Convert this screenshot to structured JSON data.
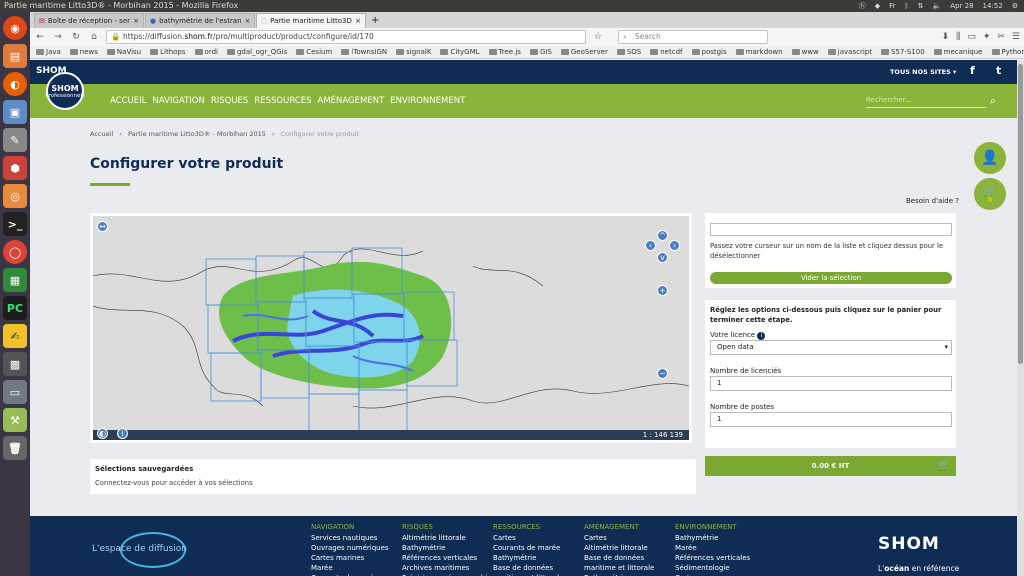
{
  "os": {
    "window_title": "Partie maritime Litto3D® - Morbihan 2015 - Mozilla Firefox",
    "tray": {
      "keyboard": "Fr",
      "date": "Apr 28",
      "time": "14:52"
    },
    "launcher_icons": [
      "ubuntu-icon",
      "files-icon",
      "firefox-icon",
      "virtualbox-icon",
      "settings-icon",
      "app-icon",
      "ubuntu-software-icon",
      "terminal-icon",
      "chrome-icon",
      "spreadsheet-icon",
      "pycharm-icon",
      "notes-icon",
      "qgis-icon",
      "drive-icon",
      "tool-icon",
      "trash-icon"
    ]
  },
  "browser": {
    "tabs": [
      {
        "label": "Boîte de réception - ser"
      },
      {
        "label": "bathymétrie de l'estran"
      },
      {
        "label": "Partie maritime Litto3D"
      }
    ],
    "url_prefix": "https://diffusion.",
    "url_host": "shom.fr",
    "url_path": "/pro/multiproduct/product/configure/id/170",
    "search_placeholder": "Search",
    "bookmarks": [
      "Java",
      "news",
      "NaVisu",
      "Lithops",
      "ordi",
      "gdal_ogr_QGis",
      "Cesium",
      "iTownsIGN",
      "signalK",
      "CityGML",
      "Tree.js",
      "GIS",
      "GeoServer",
      "SOS",
      "netcdf",
      "postgis",
      "markdown",
      "www",
      "javascript",
      "S57-S100",
      "mecanique",
      "Python",
      "Unity"
    ]
  },
  "site": {
    "logo": "SHOM",
    "tous_nos_sites": "TOUS NOS SITES",
    "social": {
      "facebook": "f",
      "twitter": "t"
    },
    "professionnels": "Professionnels",
    "menu": [
      "ACCUEIL",
      "NAVIGATION",
      "RISQUES",
      "RESSOURCES",
      "AMÉNAGEMENT",
      "ENVIRONNEMENT"
    ],
    "search_placeholder": "Rechercher...",
    "breadcrumb": [
      "Accueil",
      "Partie maritime Litto3D® - Morbihan 2015",
      "Configurer votre produit"
    ],
    "page_title": "Configurer votre produit",
    "help": "Besoin d'aide ?",
    "cart_count": "0",
    "map": {
      "scale": "1 : 146 139"
    },
    "selection": {
      "hint": "Passez votre curseur sur un nom de la liste et cliquez dessus pour le désélectionner",
      "clear_button": "Vider la sélection"
    },
    "options": {
      "intro": "Réglez les options ci-dessous puis cliquez sur le panier pour terminer cette étape.",
      "licence_label": "Votre licence",
      "licence_value": "Open data",
      "licencies_label": "Nombre de licenciés",
      "licencies_value": "1",
      "postes_label": "Nombre de postes",
      "postes_value": "1",
      "price": "0.00 € HT"
    },
    "saved": {
      "title": "Sélections sauvegardées",
      "text": "Connectez-vous pour accéder à vos sélections"
    },
    "footer": {
      "tagline": "L'espace de diffusion",
      "logo": "SHOM",
      "slogan_prefix": "L'",
      "slogan_strong": "océan",
      "slogan_suffix": " en référence",
      "columns": [
        {
          "title": "NAVIGATION",
          "items": [
            "Services nautiques",
            "Ouvrages numériques",
            "Cartes marines",
            "Marée",
            "Courants de marée"
          ]
        },
        {
          "title": "RISQUES",
          "items": [
            "Altimétrie littorale",
            "Bathymétrie",
            "Références verticales",
            "Archives maritimes",
            "Prévisions océanographiques"
          ]
        },
        {
          "title": "RESSOURCES",
          "items": [
            "Cartes",
            "Courants de marée",
            "Bathymétrie",
            "Base de données maritime et littorale"
          ]
        },
        {
          "title": "AMÉNAGEMENT",
          "items": [
            "Cartes",
            "Altimétrie littorale",
            "Base de données maritime et littorale",
            "Bathymétrie"
          ]
        },
        {
          "title": "ENVIRONNEMENT",
          "items": [
            "Bathymétrie",
            "Marée",
            "Références verticales",
            "Sédimentologie",
            "Cartes"
          ]
        }
      ]
    }
  }
}
